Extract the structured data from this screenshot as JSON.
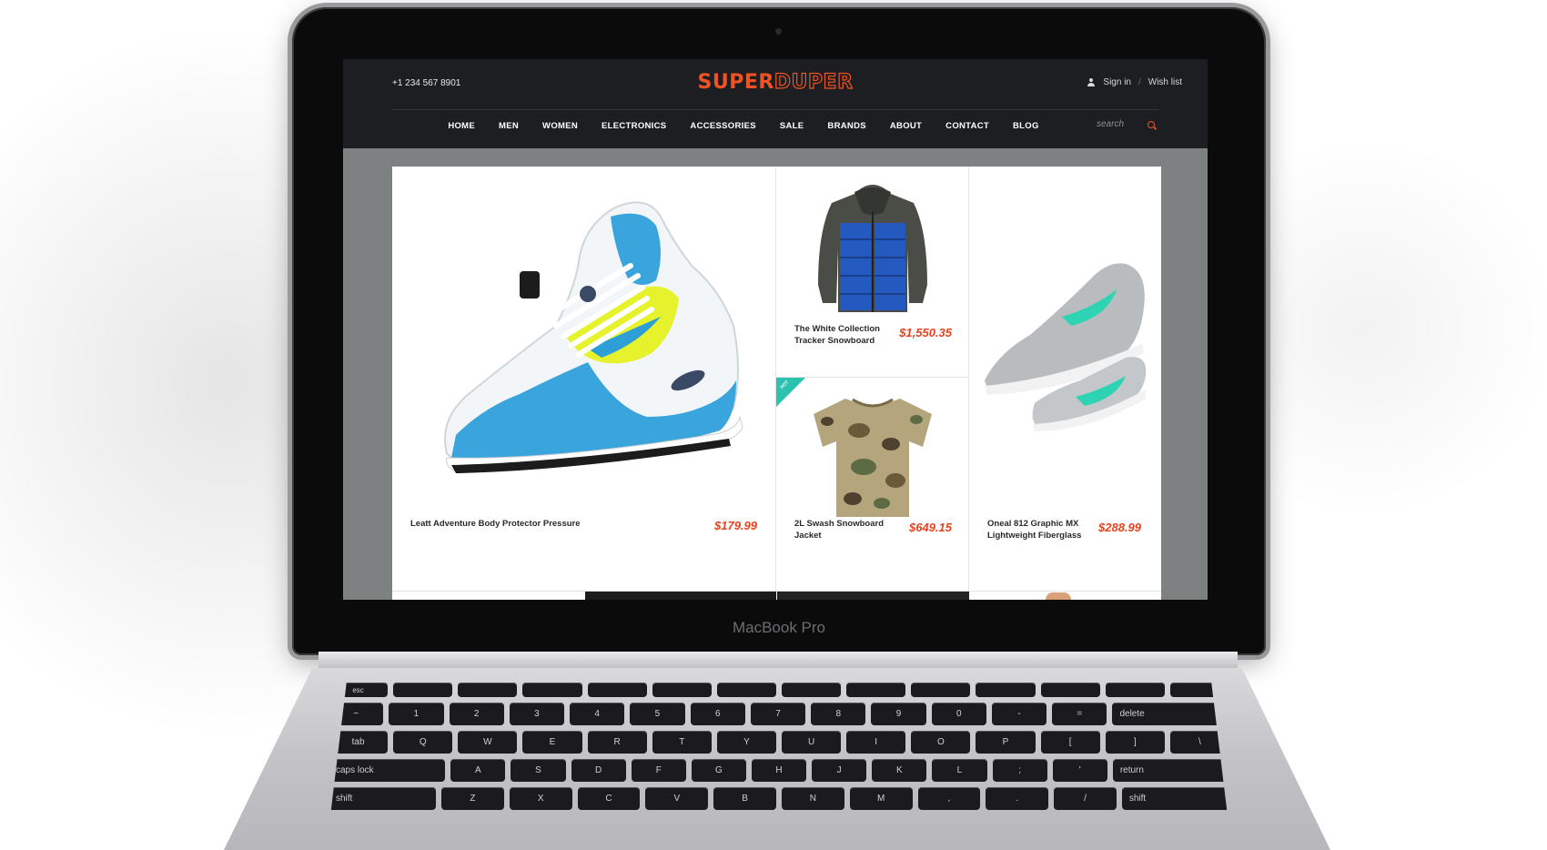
{
  "device": {
    "label": "MacBook Pro"
  },
  "header": {
    "phone": "+1 234 567 8901",
    "logo": {
      "part1": "SUPER",
      "part2": "DUPER"
    },
    "account": {
      "sign_in": "Sign in",
      "separator": "/",
      "wish_list": "Wish list"
    }
  },
  "nav": {
    "items": [
      "HOME",
      "MEN",
      "WOMEN",
      "ELECTRONICS",
      "ACCESSORIES",
      "SALE",
      "BRANDS",
      "ABOUT",
      "CONTACT",
      "BLOG"
    ],
    "search_placeholder": "search"
  },
  "products": [
    {
      "name": "Leatt Adventure Body Protector Pressure",
      "price": "$179.99",
      "image": "running-sneaker-blue-yellow"
    },
    {
      "name": "The White Collection Tracker Snowboard",
      "price": "$1,550.35",
      "image": "puffer-jacket-blue"
    },
    {
      "name": "2L Swash Snowboard Jacket",
      "price": "$649.15",
      "image": "camo-tshirt",
      "badge": "HOT"
    },
    {
      "name": "Oneal 812 Graphic MX Lightweight Fiberglass",
      "price": "$288.99",
      "image": "grey-skate-shoes"
    }
  ],
  "keyboard": {
    "rows": [
      [
        "esc",
        "",
        "",
        "",
        "",
        "",
        "",
        "",
        "",
        "",
        "",
        "",
        "",
        ""
      ],
      [
        "~",
        "1",
        "2",
        "3",
        "4",
        "5",
        "6",
        "7",
        "8",
        "9",
        "0",
        "-",
        "=",
        "delete"
      ],
      [
        "tab",
        "Q",
        "W",
        "E",
        "R",
        "T",
        "Y",
        "U",
        "I",
        "O",
        "P",
        "[",
        "]",
        "\\"
      ],
      [
        "caps lock",
        "A",
        "S",
        "D",
        "F",
        "G",
        "H",
        "J",
        "K",
        "L",
        ";",
        "'",
        "return"
      ],
      [
        "shift",
        "Z",
        "X",
        "C",
        "V",
        "B",
        "N",
        "M",
        ",",
        ".",
        "/",
        "shift"
      ]
    ]
  },
  "colors": {
    "accent": "#f05323",
    "price": "#e8431f",
    "header_bg": "#1c1e22",
    "badge": "#2bc2b0",
    "screen_bg": "#7d8182"
  }
}
